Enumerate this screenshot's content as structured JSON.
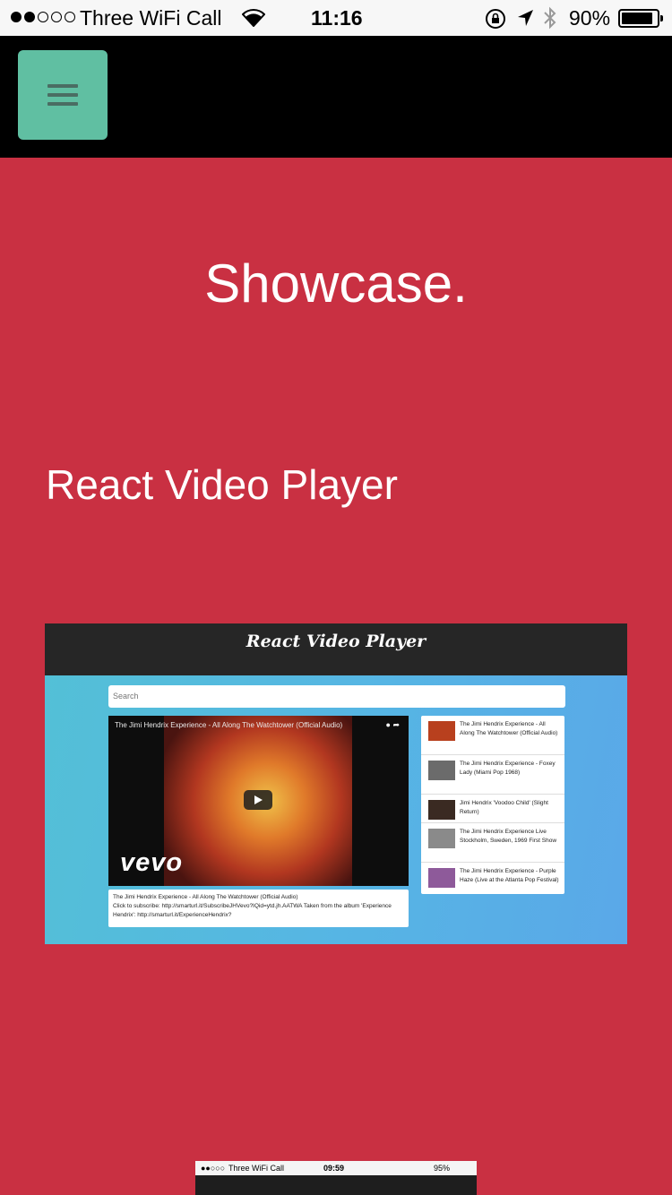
{
  "status_bar": {
    "carrier": "Three WiFi Call",
    "time": "11:16",
    "battery": "90%",
    "battery_level": 0.9,
    "signal_bars": 2
  },
  "nav": {
    "menu_icon": "hamburger-menu-icon",
    "menu_color": "#60bfa2"
  },
  "page": {
    "title": "Showcase.",
    "background": "#c93042"
  },
  "project": {
    "title": "React Video Player",
    "preview": {
      "header_title": "React Video Player",
      "search_placeholder": "Search",
      "video_title": "The Jimi Hendrix Experience - All Along The Watchtower (Official Audio)",
      "vevo_label": "vevo",
      "description_title": "The Jimi Hendrix Experience - All Along The Watchtower (Official Audio)",
      "description_body": "Click to subscribe: http://smarturl.it/SubscribeJHVevo?IQid=ytd.jh.AATWA Taken from the album 'Experience Hendrix': http://smarturl.it/ExperienceHendrix?",
      "list": [
        {
          "title": "The Jimi Hendrix Experience - All Along The Watchtower (Official Audio)",
          "thumb_color": "#b8401e"
        },
        {
          "title": "The Jimi Hendrix Experience - Foxey Lady (Miami Pop 1968)",
          "thumb_color": "#6b6b6b"
        },
        {
          "title": "Jimi Hendrix 'Voodoo Child' (Slight Return)",
          "thumb_color": "#3a2a22"
        },
        {
          "title": "The Jimi Hendrix Experience Live Stockholm, Sweden, 1969 First Show",
          "thumb_color": "#8a8a8a"
        },
        {
          "title": "The Jimi Hendrix Experience - Purple Haze (Live at the Atlanta Pop Festival)",
          "thumb_color": "#8e5a9a"
        }
      ]
    }
  },
  "next_preview": {
    "carrier": "Three WiFi Call",
    "time": "09:59",
    "battery": "95%"
  }
}
